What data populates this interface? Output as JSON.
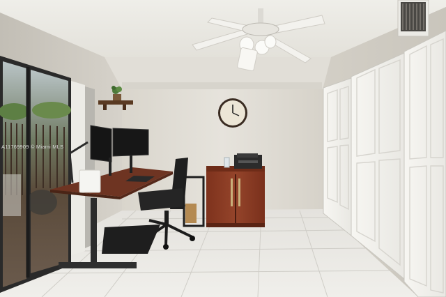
{
  "photo": {
    "watermark": "A11769909 © Miami MLS",
    "subject_objects": [
      "ceiling-fan",
      "air-vent",
      "wall-clock",
      "wall-shelf",
      "potted-plant",
      "sliding-glass-door",
      "standing-desk",
      "dual-monitors",
      "office-chair",
      "wooden-cabinet",
      "printer",
      "bifold-closet-doors",
      "tile-floor",
      "floor-mat"
    ],
    "colors": {
      "wall": "#e2ded6",
      "ceiling": "#ecebe6",
      "floor_tile": "#e9e7e2",
      "cabinet": "#8b3a22",
      "desk_top": "#7a3b26",
      "closet_door": "#f4f3ef"
    }
  }
}
